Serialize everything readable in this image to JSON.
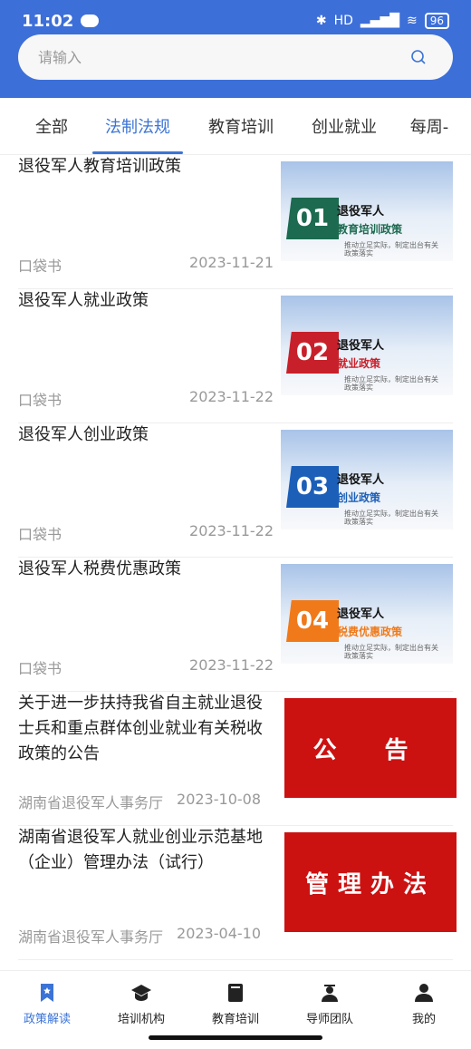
{
  "status": {
    "time": "11:02",
    "battery": "96",
    "signal": "HD"
  },
  "search": {
    "placeholder": "请输入"
  },
  "tabs": [
    {
      "label": "全部"
    },
    {
      "label": "法制法规",
      "active": true
    },
    {
      "label": "教育培训"
    },
    {
      "label": "创业就业"
    },
    {
      "label": "每周-"
    }
  ],
  "articles": [
    {
      "title": "退役军人教育培训政策",
      "source": "口袋书",
      "date": "2023-11-21",
      "thumb": {
        "num": "01",
        "line1": "退役军人",
        "line2": "教育培训政策",
        "accent": "#1c6a4f",
        "line3": "推动立足实际，制定出台有关政策落实"
      }
    },
    {
      "title": "退役军人就业政策",
      "source": "口袋书",
      "date": "2023-11-22",
      "thumb": {
        "num": "02",
        "line1": "退役军人",
        "line2": "就业政策",
        "accent": "#c8202a",
        "line3": "推动立足实际，制定出台有关政策落实"
      }
    },
    {
      "title": "退役军人创业政策",
      "source": "口袋书",
      "date": "2023-11-22",
      "thumb": {
        "num": "03",
        "line1": "退役军人",
        "line2": "创业政策",
        "accent": "#1c5fb8",
        "line3": "推动立足实际，制定出台有关政策落实"
      }
    },
    {
      "title": "退役军人税费优惠政策",
      "source": "口袋书",
      "date": "2023-11-22",
      "thumb": {
        "num": "04",
        "line1": "退役军人",
        "line2": "税费优惠政策",
        "accent": "#f07a1a",
        "line3": "推动立足实际，制定出台有关政策落实"
      }
    },
    {
      "title": "关于进一步扶持我省自主就业退役士兵和重点群体创业就业有关税收政策的公告",
      "source": "湖南省退役军人事务厅",
      "date": "2023-10-08",
      "card": "公 告"
    },
    {
      "title": "湖南省退役军人就业创业示范基地（企业）管理办法（试行）",
      "source": "湖南省退役军人事务厅",
      "date": "2023-04-10",
      "card": "管理办法"
    }
  ],
  "nav": [
    {
      "label": "政策解读",
      "icon": "bookmark-icon",
      "active": true
    },
    {
      "label": "培训机构",
      "icon": "graduation-cap-icon"
    },
    {
      "label": "教育培训",
      "icon": "book-icon"
    },
    {
      "label": "导师团队",
      "icon": "teacher-icon"
    },
    {
      "label": "我的",
      "icon": "user-icon"
    }
  ],
  "colors": {
    "header": "#3d6fd8",
    "accent": "#3b74d6",
    "red": "#cc1111"
  }
}
